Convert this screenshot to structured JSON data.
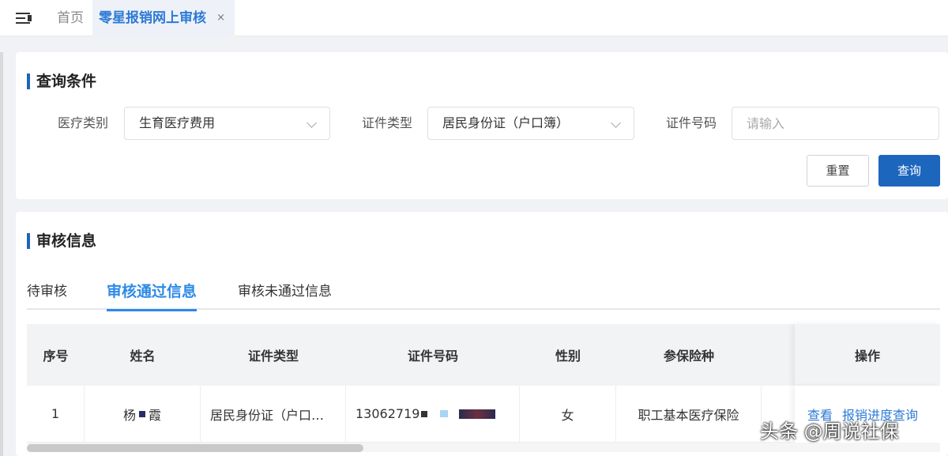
{
  "topbar": {
    "home_tab": "首页",
    "active_tab": "零星报销网上审核",
    "close_symbol": "×"
  },
  "query": {
    "title": "查询条件",
    "medical_type_label": "医疗类别",
    "medical_type_value": "生育医疗费用",
    "id_type_label": "证件类型",
    "id_type_value": "居民身份证（户口簿）",
    "id_number_label": "证件号码",
    "id_number_placeholder": "请输入",
    "reset_label": "重置",
    "search_label": "查询"
  },
  "audit": {
    "title": "审核信息",
    "tabs": [
      "待审核",
      "审核通过信息",
      "审核未通过信息"
    ],
    "active_tab_index": 1,
    "columns": [
      "序号",
      "姓名",
      "证件类型",
      "证件号码",
      "性别",
      "参保险种",
      "操作"
    ],
    "rows": [
      {
        "index": "1",
        "name_first": "杨",
        "name_last": "霞",
        "id_type": "居民身份证（户口…",
        "id_number": "13062719",
        "gender": "女",
        "insurance": "职工基本医疗保险",
        "actions": [
          "查看",
          "报销进度查询"
        ]
      }
    ]
  },
  "watermark": "头条 @周说社保",
  "colors": {
    "accent": "#1d66bd",
    "link": "#2d7ad6",
    "tab_active": "#2d8ae6"
  },
  "icons": {
    "menu_toggle": "menu-fold-icon",
    "select_arrow": "chevron-down-icon",
    "close": "close-icon"
  }
}
